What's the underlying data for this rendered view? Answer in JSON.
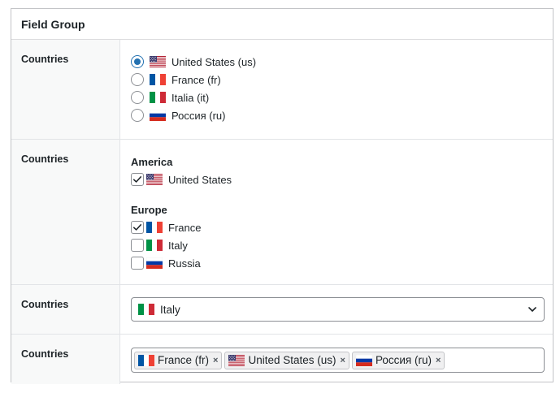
{
  "panel": {
    "title": "Field Group"
  },
  "flag_colors": {
    "us": [
      "#b22234",
      "#ffffff",
      "#3c3b6e"
    ],
    "fr": [
      "#0055a4",
      "#ffffff",
      "#ef4135"
    ],
    "it": [
      "#009246",
      "#ffffff",
      "#ce2b37"
    ],
    "ru": [
      "#ffffff",
      "#0039a6",
      "#d52b1e"
    ]
  },
  "accent_color": "#2271b1",
  "fields": {
    "radio": {
      "label": "Countries",
      "selected": "us",
      "options": [
        {
          "label": "United States (us)",
          "flag": "us-flag-icon"
        },
        {
          "label": "France (fr)",
          "flag": "fr-flag-icon"
        },
        {
          "label": "Italia (it)",
          "flag": "it-flag-icon"
        },
        {
          "label": "Россия (ru)",
          "flag": "ru-flag-icon"
        }
      ]
    },
    "checkbox": {
      "label": "Countries",
      "groups": [
        {
          "title": "America",
          "items": [
            {
              "label": "United States",
              "checked": true,
              "flag": "us-flag-icon"
            }
          ]
        },
        {
          "title": "Europe",
          "items": [
            {
              "label": "France",
              "checked": true,
              "flag": "fr-flag-icon"
            },
            {
              "label": "Italy",
              "checked": false,
              "flag": "it-flag-icon"
            },
            {
              "label": "Russia",
              "checked": false,
              "flag": "ru-flag-icon"
            }
          ]
        }
      ]
    },
    "select": {
      "label": "Countries",
      "value": "Italy",
      "flag": "it-flag-icon"
    },
    "multiselect": {
      "label": "Countries",
      "tags": [
        {
          "label": "France (fr)",
          "flag": "fr-flag-icon"
        },
        {
          "label": "United States (us)",
          "flag": "us-flag-icon"
        },
        {
          "label": "Россия (ru)",
          "flag": "ru-flag-icon"
        }
      ],
      "remove_symbol": "×"
    }
  }
}
